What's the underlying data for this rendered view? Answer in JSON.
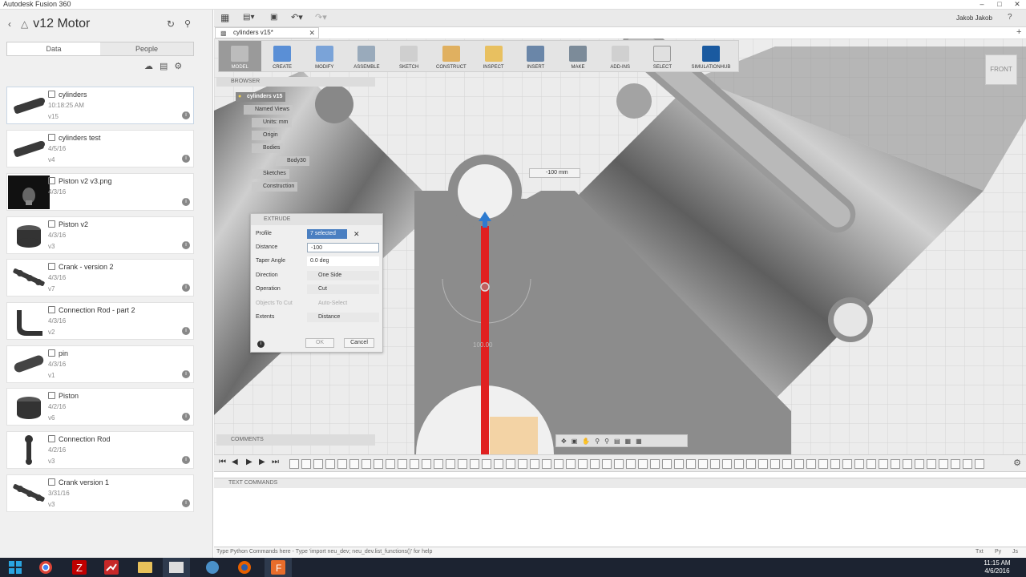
{
  "window": {
    "title": "Autodesk Fusion 360"
  },
  "project": {
    "name": "v12 Motor"
  },
  "left_tabs": [
    {
      "label": "Data"
    },
    {
      "label": "People"
    }
  ],
  "files": [
    {
      "name": "cylinders",
      "date": "10:18:25 AM",
      "version": "v15"
    },
    {
      "name": "cylinders test",
      "date": "4/5/16",
      "version": "v4"
    },
    {
      "name": "Piston v2 v3.png",
      "date": "4/3/16",
      "version": ""
    },
    {
      "name": "Piston v2",
      "date": "4/3/16",
      "version": "v3"
    },
    {
      "name": "Crank - version 2",
      "date": "4/3/16",
      "version": "v7"
    },
    {
      "name": "Connection Rod - part 2",
      "date": "4/3/16",
      "version": "v2"
    },
    {
      "name": "pin",
      "date": "4/3/16",
      "version": "v1"
    },
    {
      "name": "Piston",
      "date": "4/2/16",
      "version": "v6"
    },
    {
      "name": "Connection Rod",
      "date": "4/2/16",
      "version": "v3"
    },
    {
      "name": "Crank version 1",
      "date": "3/31/16",
      "version": "v3"
    }
  ],
  "user": {
    "name": "Jakob Jakob"
  },
  "doc_tab": {
    "label": "cylinders v15*"
  },
  "toolbar": [
    {
      "label": "MODEL"
    },
    {
      "label": "CREATE"
    },
    {
      "label": "MODIFY"
    },
    {
      "label": "ASSEMBLE"
    },
    {
      "label": "SKETCH"
    },
    {
      "label": "CONSTRUCT"
    },
    {
      "label": "INSPECT"
    },
    {
      "label": "INSERT"
    },
    {
      "label": "MAKE"
    },
    {
      "label": "ADD-INS"
    },
    {
      "label": "SELECT"
    },
    {
      "label": "SIMULATIONHUB"
    }
  ],
  "browser": {
    "title": "BROWSER",
    "root": "cylinders v15",
    "nodes": [
      "Named Views",
      "Units: mm",
      "Origin",
      "Bodies",
      "Body30",
      "Sketches",
      "Construction"
    ]
  },
  "viewcube": {
    "face": "FRONT"
  },
  "dimension_tag": "-100 mm",
  "extrude": {
    "title": "EXTRUDE",
    "rows": [
      {
        "label": "Profile",
        "value": "7 selected"
      },
      {
        "label": "Distance",
        "value": "-100"
      },
      {
        "label": "Taper Angle",
        "value": "0.0 deg"
      },
      {
        "label": "Direction",
        "value": "One Side"
      },
      {
        "label": "Operation",
        "value": "Cut"
      },
      {
        "label": "Objects To Cut",
        "value": "Auto-Select"
      },
      {
        "label": "Extents",
        "value": "Distance"
      }
    ],
    "ok": "OK",
    "cancel": "Cancel"
  },
  "canvas_label": "100.00",
  "comments": {
    "title": "COMMENTS"
  },
  "text_commands": {
    "title": "TEXT COMMANDS"
  },
  "cmdline": {
    "placeholder": "Type Python Commands here - Type 'import neu_dev; neu_dev.list_functions()' for help"
  },
  "cmdline_right": [
    "Txt",
    "Py",
    "Js"
  ],
  "clock": {
    "time": "11:15 AM",
    "date": "4/6/2016"
  },
  "colors": {
    "accent": "#4a7fc1",
    "red_axis": "#e02020",
    "taskbar": "#1c2331"
  }
}
